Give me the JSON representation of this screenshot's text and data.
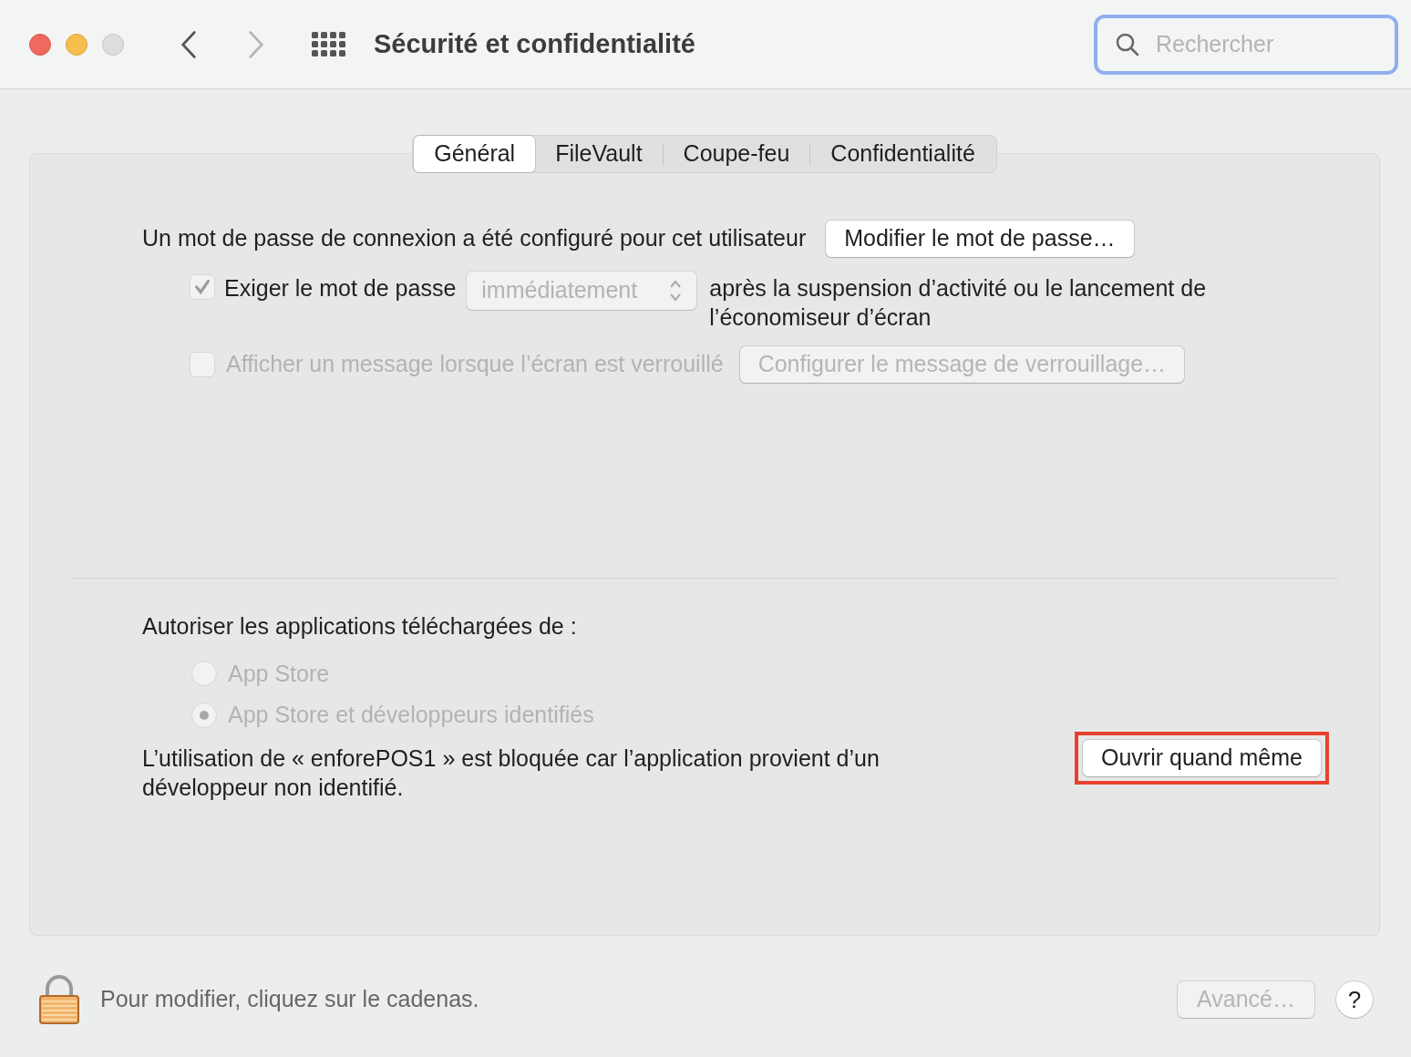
{
  "window": {
    "title": "Sécurité et confidentialité",
    "back_enabled": true,
    "forward_enabled": false
  },
  "search": {
    "placeholder": "Rechercher",
    "focused": true
  },
  "tabs": [
    {
      "label": "Général",
      "selected": true
    },
    {
      "label": "FileVault",
      "selected": false
    },
    {
      "label": "Coupe-feu",
      "selected": false
    },
    {
      "label": "Confidentialité",
      "selected": false
    }
  ],
  "password": {
    "text": "Un mot de passe de connexion a été configuré pour cet utilisateur",
    "button": {
      "label": "Modifier le mot de passe…",
      "disabled": false
    }
  },
  "require_password": {
    "label": "Exiger le mot de passe",
    "checked": true,
    "disabled": true,
    "popup": {
      "value": "immédiatement",
      "disabled": true
    },
    "after_text": "après la suspension d’activité ou le lancement de l’économiseur d’écran"
  },
  "lock_message": {
    "label": "Afficher un message lorsque l’écran est verrouillé",
    "checked": false,
    "disabled": true,
    "button": {
      "label": "Configurer le message de verrouillage…",
      "disabled": true
    }
  },
  "allow_apps": {
    "heading": "Autoriser les applications téléchargées de :",
    "options": [
      {
        "label": "App Store",
        "selected": false,
        "disabled": true
      },
      {
        "label": "App Store et développeurs identifiés",
        "selected": true,
        "disabled": true
      }
    ]
  },
  "blocked": {
    "text": "L’utilisation de « enforePOS1 » est bloquée car l’application provient d’un développeur non identifié.",
    "button": {
      "label": "Ouvrir quand même",
      "disabled": false,
      "highlighted": true
    }
  },
  "footer": {
    "lock_text": "Pour modifier, cliquez sur le cadenas.",
    "advanced": {
      "label": "Avancé…",
      "disabled": true
    },
    "help": "?"
  }
}
